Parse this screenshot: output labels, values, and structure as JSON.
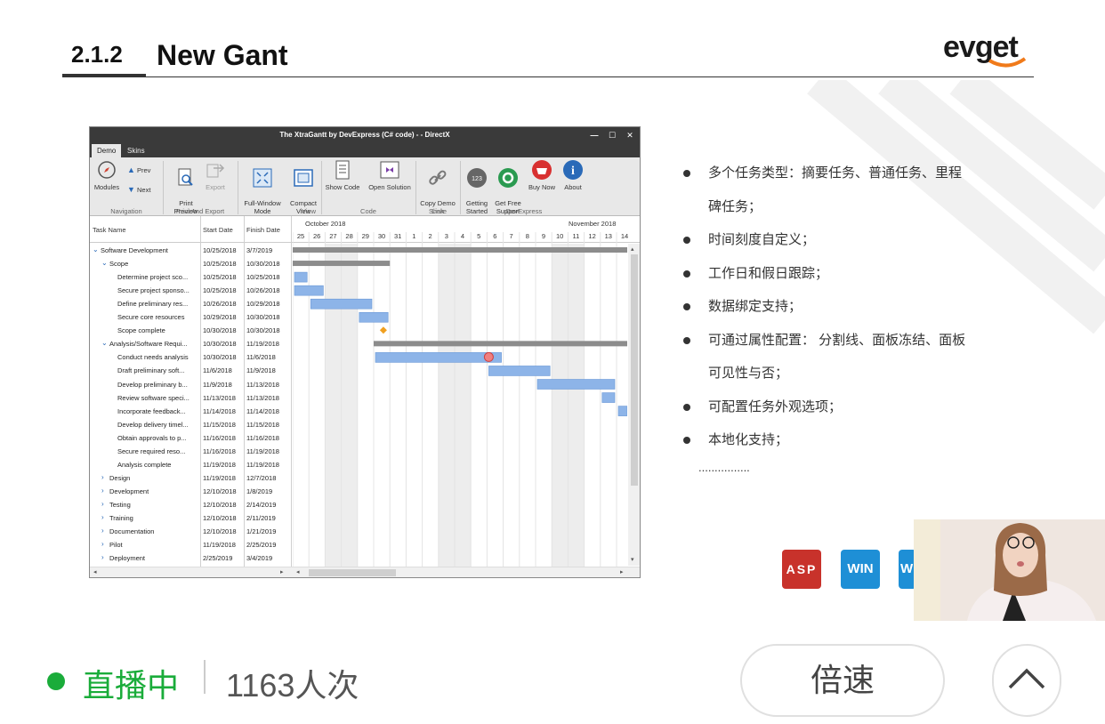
{
  "slide": {
    "number": "2.1.2",
    "title": "New Gant",
    "logo": "evget"
  },
  "window": {
    "title": "The XtraGantt by DevExpress (C# code) -  - DirectX",
    "controls": [
      "—",
      "☐",
      "✕"
    ],
    "tabs": [
      "Demo",
      "Skins"
    ],
    "ribbon": {
      "buttons": [
        {
          "label": "Modules",
          "icon": "compass-icon"
        },
        {
          "label": "Prev",
          "icon": "up-triangle-icon"
        },
        {
          "label": "Next",
          "icon": "down-triangle-icon"
        },
        {
          "label": "Print\nPreview",
          "icon": "print-preview-icon"
        },
        {
          "label": "Export",
          "icon": "export-icon"
        },
        {
          "label": "Full-Window\nMode",
          "icon": "fullscreen-icon"
        },
        {
          "label": "Compact\nView",
          "icon": "compact-view-icon"
        },
        {
          "label": "Show Code",
          "icon": "code-doc-icon"
        },
        {
          "label": "Open Solution",
          "icon": "visual-studio-icon"
        },
        {
          "label": "Copy Demo\nLink",
          "icon": "link-icon"
        },
        {
          "label": "Getting\nStarted",
          "icon": "getting-started-icon"
        },
        {
          "label": "Get Free\nSupport",
          "icon": "support-icon"
        },
        {
          "label": "Buy Now",
          "icon": "basket-icon"
        },
        {
          "label": "About",
          "icon": "info-icon"
        }
      ],
      "groups": [
        "Navigation",
        "Print And Export",
        "View",
        "Code",
        "Share",
        "DevExpress"
      ]
    },
    "grid": {
      "columns": [
        "Task Name",
        "Start Date",
        "Finish Date"
      ],
      "months": [
        "October 2018",
        "November 2018"
      ],
      "days": [
        "25",
        "26",
        "27",
        "28",
        "29",
        "30",
        "31",
        "1",
        "2",
        "3",
        "4",
        "5",
        "6",
        "7",
        "8",
        "9",
        "10",
        "11",
        "12",
        "13",
        "14"
      ],
      "rows": [
        {
          "name": "Software Development",
          "start": "10/25/2018",
          "finish": "3/7/2019",
          "level": 0,
          "expander": "⌄"
        },
        {
          "name": "Scope",
          "start": "10/25/2018",
          "finish": "10/30/2018",
          "level": 1,
          "expander": "⌄"
        },
        {
          "name": "Determine project sco...",
          "start": "10/25/2018",
          "finish": "10/25/2018",
          "level": 2,
          "expander": ""
        },
        {
          "name": "Secure project sponso...",
          "start": "10/25/2018",
          "finish": "10/26/2018",
          "level": 2,
          "expander": ""
        },
        {
          "name": "Define preliminary res...",
          "start": "10/26/2018",
          "finish": "10/29/2018",
          "level": 2,
          "expander": ""
        },
        {
          "name": "Secure core resources",
          "start": "10/29/2018",
          "finish": "10/30/2018",
          "level": 2,
          "expander": ""
        },
        {
          "name": "Scope complete",
          "start": "10/30/2018",
          "finish": "10/30/2018",
          "level": 2,
          "expander": ""
        },
        {
          "name": "Analysis/Software Requi...",
          "start": "10/30/2018",
          "finish": "11/19/2018",
          "level": 1,
          "expander": "⌄"
        },
        {
          "name": "Conduct needs analysis",
          "start": "10/30/2018",
          "finish": "11/6/2018",
          "level": 2,
          "expander": ""
        },
        {
          "name": "Draft preliminary soft...",
          "start": "11/6/2018",
          "finish": "11/9/2018",
          "level": 2,
          "expander": ""
        },
        {
          "name": "Develop preliminary b...",
          "start": "11/9/2018",
          "finish": "11/13/2018",
          "level": 2,
          "expander": ""
        },
        {
          "name": "Review software speci...",
          "start": "11/13/2018",
          "finish": "11/13/2018",
          "level": 2,
          "expander": ""
        },
        {
          "name": "Incorporate feedback...",
          "start": "11/14/2018",
          "finish": "11/14/2018",
          "level": 2,
          "expander": ""
        },
        {
          "name": "Develop delivery timel...",
          "start": "11/15/2018",
          "finish": "11/15/2018",
          "level": 2,
          "expander": ""
        },
        {
          "name": "Obtain approvals to p...",
          "start": "11/16/2018",
          "finish": "11/16/2018",
          "level": 2,
          "expander": ""
        },
        {
          "name": "Secure required reso...",
          "start": "11/16/2018",
          "finish": "11/19/2018",
          "level": 2,
          "expander": ""
        },
        {
          "name": "Analysis complete",
          "start": "11/19/2018",
          "finish": "11/19/2018",
          "level": 2,
          "expander": ""
        },
        {
          "name": "Design",
          "start": "11/19/2018",
          "finish": "12/7/2018",
          "level": 1,
          "expander": "›"
        },
        {
          "name": "Development",
          "start": "12/10/2018",
          "finish": "1/8/2019",
          "level": 1,
          "expander": "›"
        },
        {
          "name": "Testing",
          "start": "12/10/2018",
          "finish": "2/14/2019",
          "level": 1,
          "expander": "›"
        },
        {
          "name": "Training",
          "start": "12/10/2018",
          "finish": "2/11/2019",
          "level": 1,
          "expander": "›"
        },
        {
          "name": "Documentation",
          "start": "12/10/2018",
          "finish": "1/21/2019",
          "level": 1,
          "expander": "›"
        },
        {
          "name": "Pilot",
          "start": "11/19/2018",
          "finish": "2/25/2019",
          "level": 1,
          "expander": "›"
        },
        {
          "name": "Deployment",
          "start": "2/25/2019",
          "finish": "3/4/2019",
          "level": 1,
          "expander": "›"
        }
      ]
    }
  },
  "bullets": [
    {
      "text": "多个任务类型：摘要任务、普通任务、里程",
      "bullet": true
    },
    {
      "text": "碑任务；",
      "bullet": false
    },
    {
      "text": "时间刻度自定义；",
      "bullet": true
    },
    {
      "text": "工作日和假日跟踪；",
      "bullet": true
    },
    {
      "text": "数据绑定支持；",
      "bullet": true
    },
    {
      "text": "可通过属性配置： 分割线、面板冻结、面板",
      "bullet": true
    },
    {
      "text": "可见性与否；",
      "bullet": false
    },
    {
      "text": "可配置任务外观选项；",
      "bullet": true
    },
    {
      "text": "本地化支持；",
      "bullet": true
    }
  ],
  "ellipsis": "................",
  "badges": [
    {
      "label": "ASP",
      "color": "#c8322b"
    },
    {
      "label": "WIN",
      "color": "#1e8fd6"
    },
    {
      "label": "W",
      "color": "#1e8fd6"
    }
  ],
  "footer": {
    "live": "直播中",
    "viewers": "1163人次",
    "speed": "倍速",
    "collapse_icon": "chevron-up-icon"
  },
  "colors": {
    "live_green": "#1aac3a",
    "summary_bar": "#8c8c8c",
    "task_bar": "#8db4e8",
    "milestone": "#f0a020"
  }
}
